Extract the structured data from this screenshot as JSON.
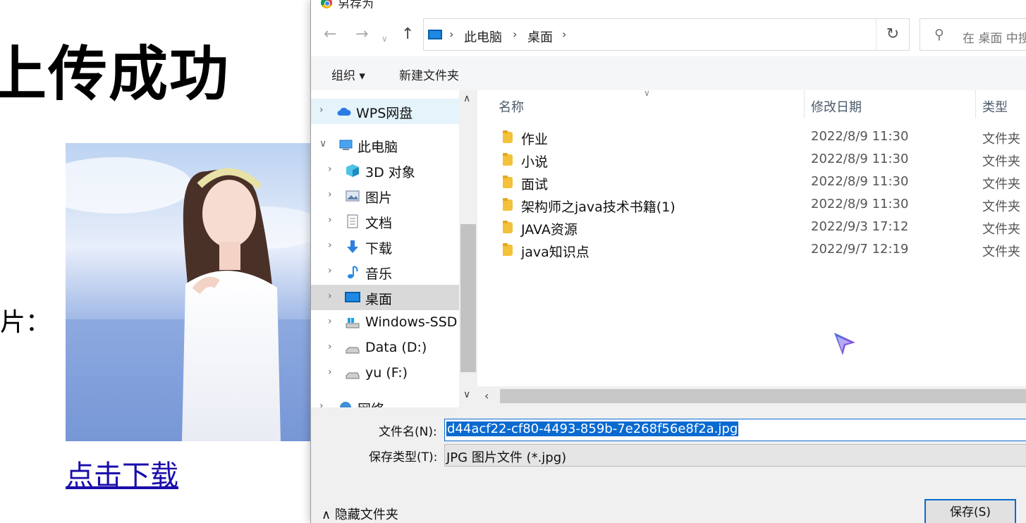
{
  "webpage": {
    "title": "上传成功",
    "image_label": "片：",
    "download_link": "点击下载"
  },
  "dialog": {
    "title": "另存为",
    "address": {
      "crumbs": [
        "此电脑",
        "桌面"
      ]
    },
    "search_placeholder": "在 桌面 中搜索",
    "toolbar": {
      "organize": "组织 ▾",
      "new_folder": "新建文件夹"
    },
    "tree": [
      {
        "label": "WPS网盘",
        "icon": "cloud-icon"
      },
      {
        "label": "此电脑",
        "icon": "computer-icon"
      },
      {
        "label": "3D 对象",
        "icon": "cube-icon"
      },
      {
        "label": "图片",
        "icon": "pictures-icon"
      },
      {
        "label": "文档",
        "icon": "document-icon"
      },
      {
        "label": "下载",
        "icon": "download-icon"
      },
      {
        "label": "音乐",
        "icon": "music-icon"
      },
      {
        "label": "桌面",
        "icon": "desktop-icon"
      },
      {
        "label": "Windows-SSD",
        "icon": "drive-icon"
      },
      {
        "label": "Data (D:)",
        "icon": "drive-icon"
      },
      {
        "label": "yu (F:)",
        "icon": "drive-icon"
      },
      {
        "label": "网络",
        "icon": "network-icon"
      }
    ],
    "columns": {
      "name": "名称",
      "modified": "修改日期",
      "type": "类型"
    },
    "files": [
      {
        "name": "作业",
        "date": "2022/8/9 11:30",
        "type": "文件夹"
      },
      {
        "name": "小说",
        "date": "2022/8/9 11:30",
        "type": "文件夹"
      },
      {
        "name": "面试",
        "date": "2022/8/9 11:30",
        "type": "文件夹"
      },
      {
        "name": "架构师之java技术书籍(1)",
        "date": "2022/8/9 11:30",
        "type": "文件夹"
      },
      {
        "name": "JAVA资源",
        "date": "2022/9/3 17:12",
        "type": "文件夹"
      },
      {
        "name": "java知识点",
        "date": "2022/9/7 12:19",
        "type": "文件夹"
      }
    ],
    "filename_label": "文件名(N):",
    "filename_value": "d44acf22-cf80-4493-859b-7e268f56e8f2a.jpg",
    "filetype_label": "保存类型(T):",
    "filetype_value": "JPG 图片文件 (*.jpg)",
    "hide_folders": "隐藏文件夹",
    "save_button": "保存(S)"
  },
  "colors": {
    "selection": "#0a6ad0",
    "link": "#1a0dab",
    "folder": "#f3c13a"
  }
}
